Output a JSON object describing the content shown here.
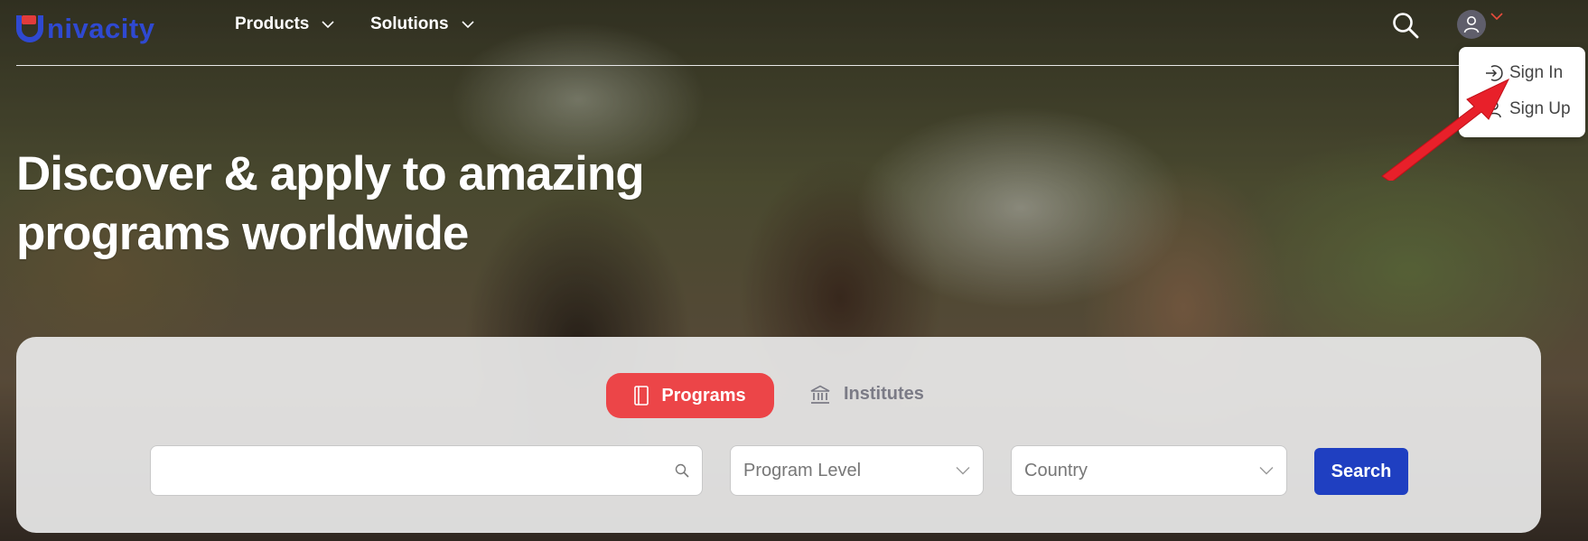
{
  "brand": {
    "name": "nivacity",
    "color": "#2f49d1"
  },
  "nav": {
    "products": "Products",
    "solutions": "Solutions"
  },
  "account_menu": {
    "sign_in": "Sign In",
    "sign_up": "Sign Up"
  },
  "hero": {
    "headline_line1": "Discover & apply to amazing",
    "headline_line2": "programs worldwide"
  },
  "search_panel": {
    "tabs": [
      {
        "label": "Programs",
        "active": true,
        "icon": "book-icon"
      },
      {
        "label": "Institutes",
        "active": false,
        "icon": "institution-icon"
      }
    ],
    "keyword_input": {
      "value": "",
      "placeholder": ""
    },
    "program_level": "Program Level",
    "country": "Country",
    "search_button": "Search"
  },
  "colors": {
    "accent_red": "#ec4548",
    "primary_blue": "#1f3fc1"
  }
}
